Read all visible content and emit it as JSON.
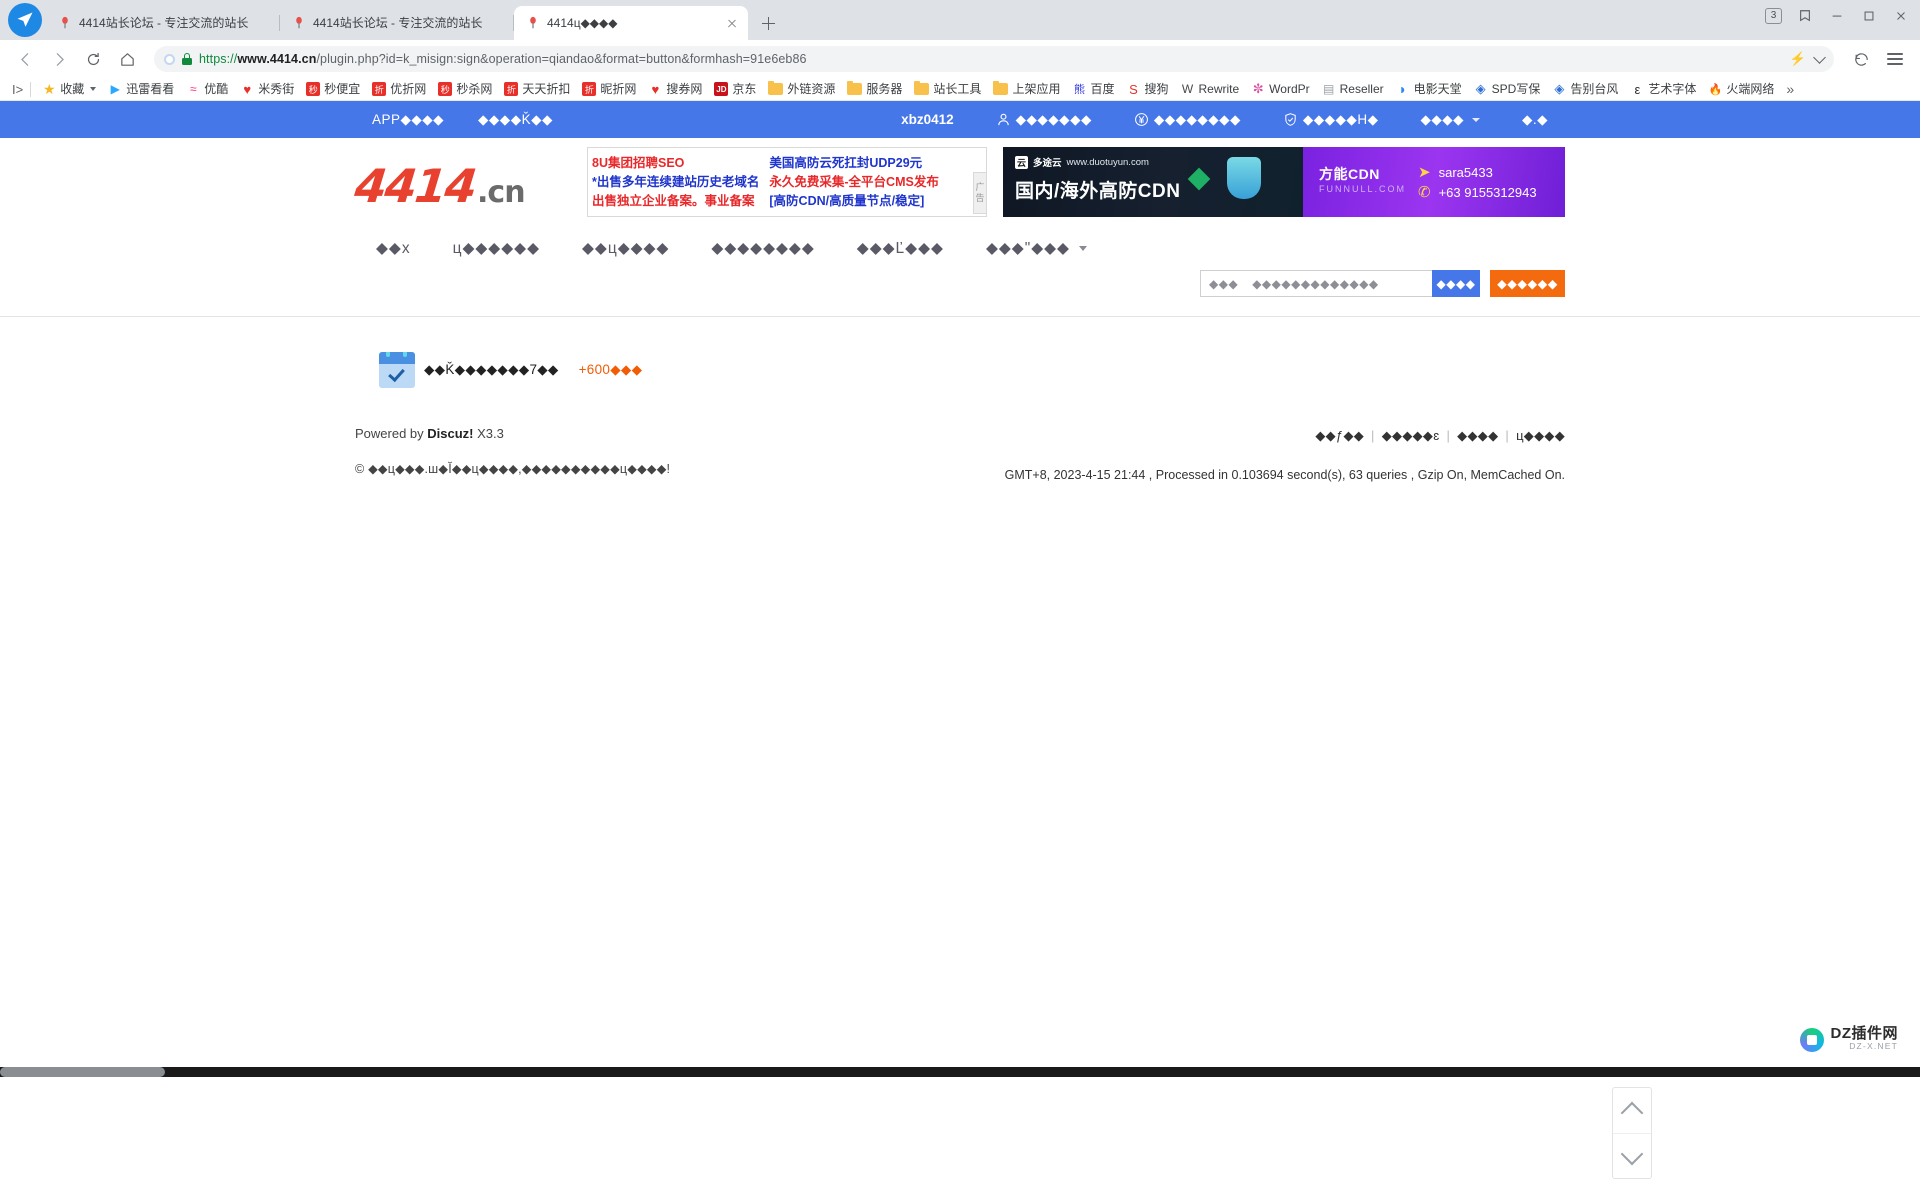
{
  "browser": {
    "tabs": [
      {
        "title": "4414站长论坛 - 专注交流的站长",
        "active": false
      },
      {
        "title": "4414站长论坛 - 专注交流的站长",
        "active": false
      },
      {
        "title": "4414ц◆◆◆◆",
        "active": true
      }
    ],
    "tab_count_badge": "3",
    "new_tab_label": "+",
    "url": {
      "scheme": "https://",
      "host": "www.4414.cn",
      "path": "/plugin.php?id=k_misign:sign&operation=qiandao&format=button&formhash=91e6eb86",
      "full": "https://www.4414.cn/plugin.php?id=k_misign:sign&operation=qiandao&format=button&formhash=91e6eb86"
    },
    "bookmarks": [
      {
        "label": "收藏",
        "icon": "star-icon",
        "color": "#f5b820",
        "glyph": "★",
        "caret": true
      },
      {
        "label": "迅雷看看",
        "icon": "xunlei-icon",
        "color": "#29a8ff",
        "glyph": "▶"
      },
      {
        "label": "优酷",
        "icon": "youku-icon",
        "color": "#ff2d7a",
        "glyph": "≈"
      },
      {
        "label": "米秀街",
        "icon": "heart-icon",
        "color": "#e8302a",
        "glyph": "♥"
      },
      {
        "label": "秒便宜",
        "icon": "miao-icon",
        "color": "#e8302a",
        "glyph": "秒"
      },
      {
        "label": "优折网",
        "icon": "zhe-icon",
        "color": "#e8302a",
        "glyph": "折"
      },
      {
        "label": "秒杀网",
        "icon": "miao-icon",
        "color": "#e8302a",
        "glyph": "秒"
      },
      {
        "label": "天天折扣",
        "icon": "zhe-icon",
        "color": "#e8302a",
        "glyph": "折"
      },
      {
        "label": "昵折网",
        "icon": "zhe-icon",
        "color": "#e8302a",
        "glyph": "折"
      },
      {
        "label": "搜券网",
        "icon": "heart-icon",
        "color": "#e8302a",
        "glyph": "♥"
      },
      {
        "label": "京东",
        "icon": "jd-icon",
        "color": "#c8121c",
        "glyph": "JD"
      },
      {
        "label": "外链资源",
        "icon": "folder-icon"
      },
      {
        "label": "服务器",
        "icon": "folder-icon"
      },
      {
        "label": "站长工具",
        "icon": "folder-icon"
      },
      {
        "label": "上架应用",
        "icon": "folder-icon"
      },
      {
        "label": "百度",
        "icon": "baidu-icon",
        "color": "#2932e1",
        "glyph": "熊"
      },
      {
        "label": "搜狗",
        "icon": "sogou-icon",
        "color": "#e8302a",
        "glyph": "S"
      },
      {
        "label": "Rewrite",
        "icon": "wordpress-icon",
        "color": "#4a4a4a",
        "glyph": "W"
      },
      {
        "label": "WordPr",
        "icon": "flower-icon",
        "color": "#d94d9e",
        "glyph": "✼"
      },
      {
        "label": "Reseller",
        "icon": "page-icon",
        "color": "#9aa0a6",
        "glyph": "▤"
      },
      {
        "label": "电影天堂",
        "icon": "browser-icon",
        "color": "#2b8bf0",
        "glyph": "◗"
      },
      {
        "label": "SPD写保",
        "icon": "spd-icon",
        "color": "#2b6fd6",
        "glyph": "◈"
      },
      {
        "label": "告别台风",
        "icon": "spd-icon",
        "color": "#2b6fd6",
        "glyph": "◈"
      },
      {
        "label": "艺术字体",
        "icon": "art-icon",
        "color": "#2f2f2f",
        "glyph": "ε"
      },
      {
        "label": "火端网络",
        "icon": "flame-icon",
        "color": "#f36a0f",
        "glyph": "🔥"
      }
    ],
    "bookmarks_overflow": "»"
  },
  "site": {
    "topbar": {
      "left": [
        "APP◆◆◆◆",
        "◆◆◆◆Ǩ◆◆"
      ],
      "username": "xbz0412",
      "right": [
        {
          "icon": "user-icon",
          "label": "◆◆◆◆◆◆◆"
        },
        {
          "icon": "yen-icon",
          "label": "◆◆◆◆◆◆◆◆"
        },
        {
          "icon": "shield-icon",
          "label": "◆◆◆◆◆H◆"
        },
        {
          "icon": "",
          "label": "◆◆◆◆",
          "caret": true
        },
        {
          "icon": "",
          "label": "◆.◆"
        }
      ]
    },
    "logo": {
      "main": "4414",
      "suffix": ".cn"
    },
    "ad_text": {
      "col1": [
        "8U集团招聘SEO",
        "*出售多年连续建站历史老域名",
        "出售独立企业备案。事业备案"
      ],
      "col2": [
        "美国高防云死扛封UDP29元",
        "永久免费采集-全平台CMS发布",
        "[高防CDN/高质量节点/稳定]"
      ],
      "tag": "广告"
    },
    "ad_cdn": {
      "brand": "多途云",
      "site": "www.duotuyun.com",
      "headline": "国内/海外高防CDN",
      "partner_cn": "方能CDN",
      "partner_en": "FUNNULL.COM",
      "contact_id": "sara5433",
      "contact_phone": "+63 9155312943"
    },
    "nav": [
      "◆◆x",
      "ц◆◆◆◆◆◆",
      "◆◆ц◆◆◆◆",
      "◆◆◆◆◆◆◆◆",
      "◆◆◆Ľ◆◆◆",
      "◆◆◆\"◆◆◆"
    ],
    "search": {
      "scope": "◆◆◆",
      "placeholder": "◆◆◆◆◆◆◆◆◆◆◆◆◆",
      "button": "◆◆◆◆",
      "post_button": "◆◆◆◆◆◆"
    },
    "signin": {
      "icon": "calendar-check-icon",
      "message": "◆◆Ǩ◆◆◆◆◆◆◆7◆◆",
      "bonus": "+600◆◆◆"
    },
    "footer": {
      "powered_prefix": "Powered by",
      "powered_brand": "Discuz!",
      "powered_version": "X3.3",
      "copyright": "© ◆◆ц◆◆◆.ш◆Ĭ◆◆ц◆◆◆◆,◆◆◆◆◆◆◆◆◆◆ц◆◆◆◆!",
      "links": [
        "◆◆ƒ◆◆",
        "◆◆◆◆◆ɛ",
        "◆◆◆◆",
        "ц◆◆◆◆"
      ],
      "stats": "GMT+8, 2023-4-15 21:44 , Processed in 0.103694 second(s), 63 queries , Gzip On, MemCached On."
    },
    "float_buttons": [
      {
        "name": "scroll-up-button",
        "icon": "chevron-up-icon"
      },
      {
        "name": "scroll-down-button",
        "icon": "chevron-down-icon"
      }
    ],
    "watermark": {
      "main": "DZ插件网",
      "sub": "DZ-X.NET"
    }
  }
}
